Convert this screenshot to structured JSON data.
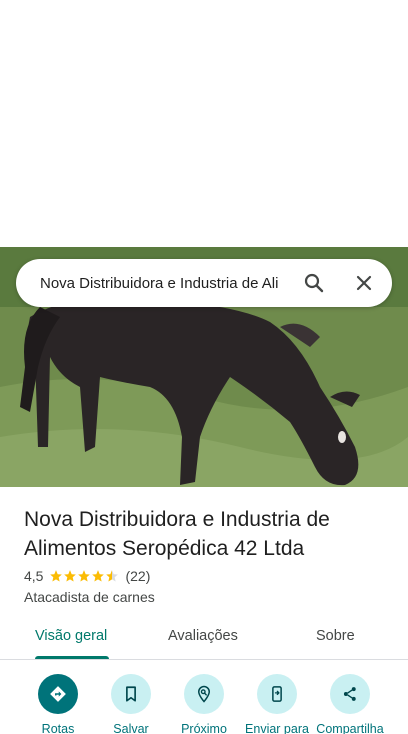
{
  "search": {
    "query": "Nova Distribuidora e Industria de Ali",
    "search_icon": "search-icon",
    "close_icon": "close-icon"
  },
  "place": {
    "title": "Nova Distribuidora e Industria de Alimentos Seropédica 42 Ltda",
    "rating": "4,5",
    "rating_stars": 4.5,
    "review_count": "(22)",
    "category": "Atacadista de carnes"
  },
  "tabs": [
    {
      "label": "Visão geral",
      "active": true
    },
    {
      "label": "Avaliações",
      "active": false
    },
    {
      "label": "Sobre",
      "active": false
    }
  ],
  "actions": [
    {
      "label": "Rotas",
      "icon": "directions-icon"
    },
    {
      "label": "Salvar",
      "icon": "bookmark-icon"
    },
    {
      "label": "Próximo",
      "icon": "nearby-icon"
    },
    {
      "label": "Enviar para",
      "icon": "send-to-phone-icon"
    },
    {
      "label": "Compartilha",
      "icon": "share-icon"
    }
  ],
  "colors": {
    "accent": "#00737a",
    "tab_active": "#00796b",
    "action_bg": "#c9f0f2",
    "star": "#fbbc04"
  }
}
